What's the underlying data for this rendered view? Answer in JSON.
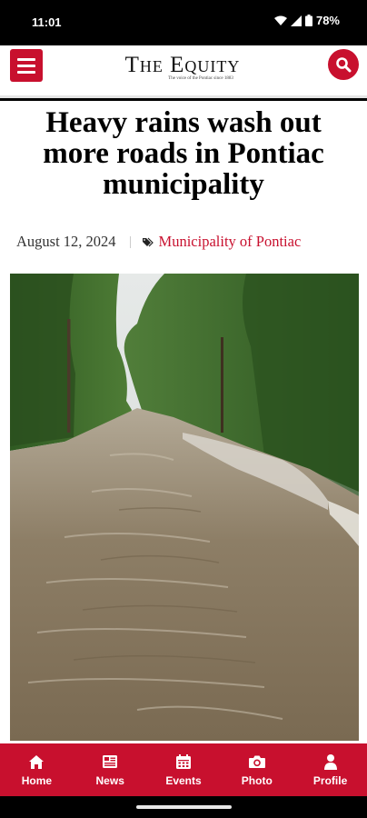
{
  "status_bar": {
    "time": "11:01",
    "battery": "78%",
    "icons": [
      "wifi-icon",
      "signal-icon",
      "battery-icon"
    ]
  },
  "header": {
    "masthead_title": "The Equity",
    "masthead_tagline": "The voice of the Pontiac since 1883",
    "menu_icon": "hamburger-menu-icon",
    "search_icon": "search-icon"
  },
  "article": {
    "headline": "Heavy rains wash out more roads in Pontiac municipality",
    "date": "August 12, 2024",
    "category": "Municipality of Pontiac",
    "category_icon": "tag-icon",
    "image": "flooded-road-photo"
  },
  "bottom_nav": {
    "items": [
      {
        "label": "Home",
        "icon": "home-icon"
      },
      {
        "label": "News",
        "icon": "newspaper-icon"
      },
      {
        "label": "Events",
        "icon": "calendar-icon"
      },
      {
        "label": "Photo",
        "icon": "camera-icon"
      },
      {
        "label": "Profile",
        "icon": "person-icon"
      }
    ]
  },
  "colors": {
    "brand_red": "#c8102e",
    "text_dark": "#000000",
    "status_bar_bg": "#000000"
  }
}
